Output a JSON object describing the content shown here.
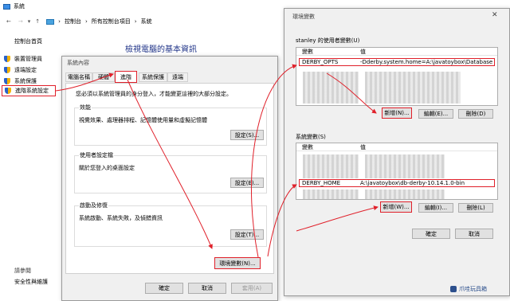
{
  "main_window": {
    "title": "系統",
    "nav": {
      "back": "←",
      "forward": "→",
      "up": "↑"
    },
    "breadcrumb": [
      "控制台",
      "所有控制台項目",
      "系統"
    ],
    "sidebar_home": "控制台首頁",
    "sidebar_items": [
      "裝置管理員",
      "遠端設定",
      "系統保護",
      "進階系統設定"
    ],
    "see_also": "請參閱",
    "see_also_item": "安全性與維護",
    "heading": "檢視電腦的基本資訊"
  },
  "sysprops": {
    "title": "系統內容",
    "tabs": [
      "電腦名稱",
      "硬體",
      "進階",
      "系統保護",
      "遠端"
    ],
    "intro": "您必須以系統管理員的身分登入，才能變更這裡的大部分設定。",
    "perf": {
      "title": "效能",
      "desc": "視覺效果、處理器排程、記憶體使用量和虛擬記憶體",
      "button": "設定(S)..."
    },
    "profile": {
      "title": "使用者設定檔",
      "desc": "關於您登入的桌面設定",
      "button": "設定(E)..."
    },
    "startup": {
      "title": "啟動及修復",
      "desc": "系統啟動、系統失敗，及偵錯資訊",
      "button": "設定(T)..."
    },
    "env_button": "環境變數(N)...",
    "ok": "確定",
    "cancel": "取消",
    "apply": "套用(A)"
  },
  "envvars": {
    "title": "環境變數",
    "user_group": "stanley 的使用者變數(U)",
    "col_var": "變數",
    "col_val": "值",
    "user_row": {
      "var": "DERBY_OPTS",
      "val": "-Dderby.system.home=A:\\javatoybox\\Database"
    },
    "user_new": "新增(N)...",
    "user_edit": "編輯(E)...",
    "user_delete": "刪除(D)",
    "sys_group": "系統變數(S)",
    "sys_row": {
      "var": "DERBY_HOME",
      "val": "A:\\javatoybox\\db-derby-10.14.1.0-bin"
    },
    "sys_new": "新增(W)...",
    "sys_edit": "編輯(I)...",
    "sys_delete": "刪除(L)",
    "ok": "確定",
    "cancel": "取消",
    "close": "✕",
    "watermark": "爪哇玩具箱"
  },
  "colors": {
    "accent": "#0078d7",
    "highlight_red": "#e0202a"
  }
}
